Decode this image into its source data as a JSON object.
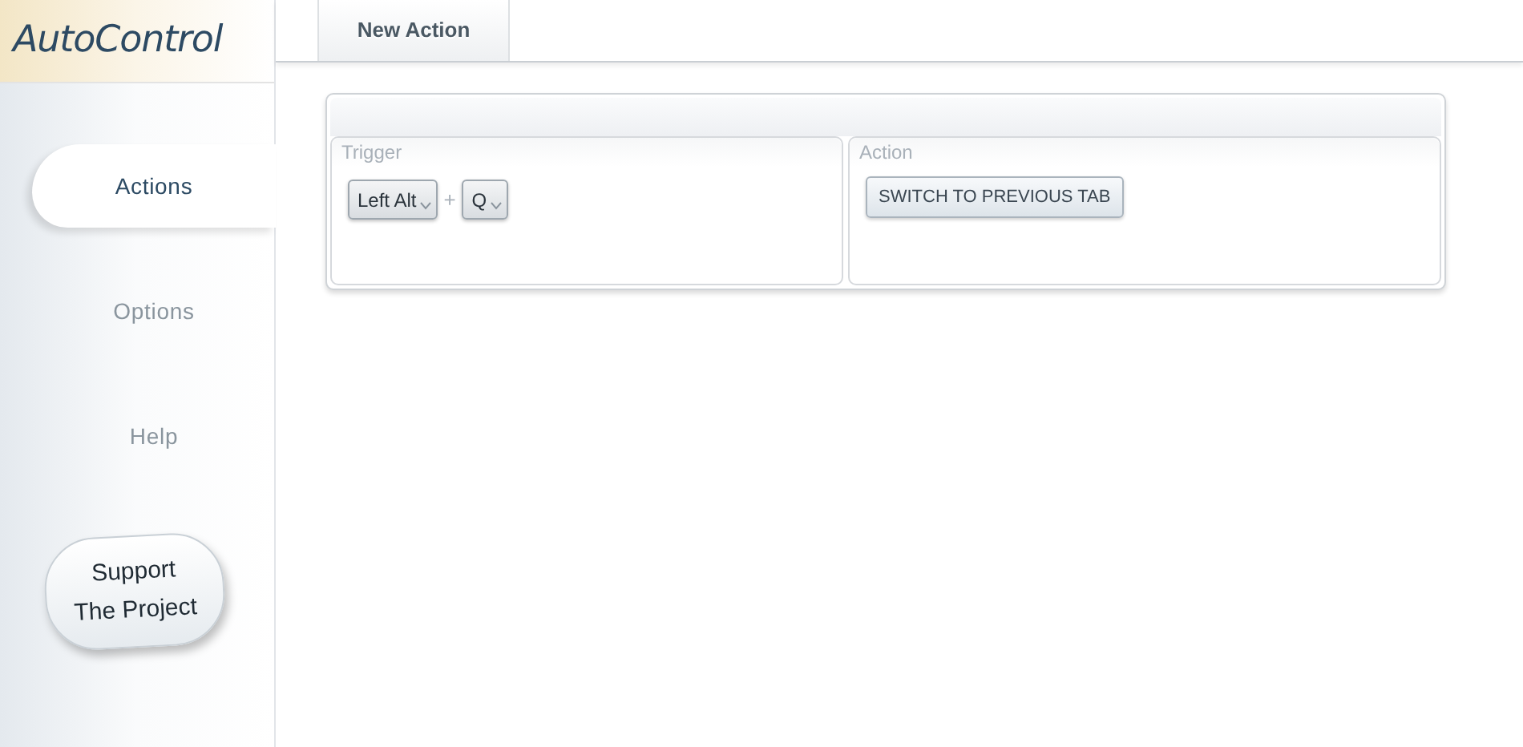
{
  "app": {
    "logo": "AutoControl"
  },
  "sidebar": {
    "items": [
      {
        "label": "Actions",
        "selected": true
      },
      {
        "label": "Options",
        "selected": false
      },
      {
        "label": "Help",
        "selected": false
      }
    ],
    "support_button": {
      "lines": [
        "Support",
        "The Project"
      ]
    }
  },
  "tabs": [
    {
      "label": "New Action",
      "selected": true
    }
  ],
  "trigger": {
    "title": "Trigger",
    "keys": [
      "Left Alt",
      "Q"
    ],
    "separator": "+"
  },
  "action": {
    "title": "Action",
    "button": "SWITCH TO PREVIOUS TAB"
  }
}
